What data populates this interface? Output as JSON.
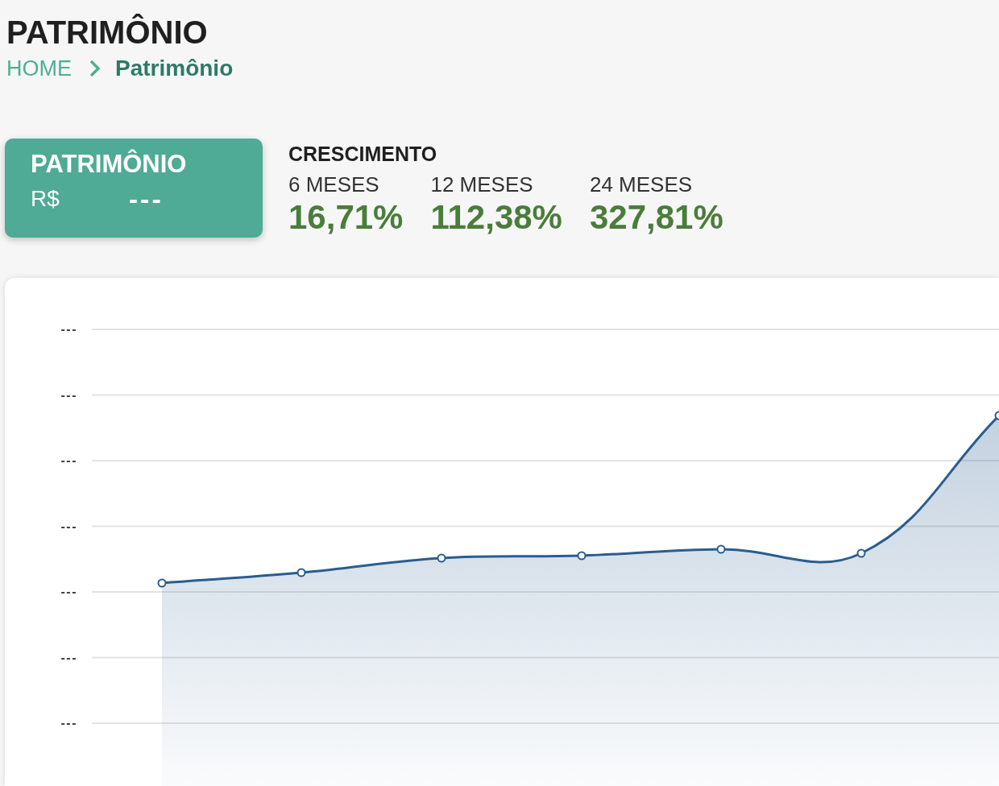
{
  "page": {
    "title": "PATRIMÔNIO"
  },
  "breadcrumb": [
    {
      "label": "HOME",
      "current": false
    },
    {
      "label": "Patrimônio",
      "current": true
    }
  ],
  "summary_card": {
    "title": "PATRIMÔNIO",
    "currency": "R$",
    "value": "---"
  },
  "growth": {
    "title": "CRESCIMENTO",
    "periods": [
      {
        "label": "6 MESES",
        "value": "16,71%"
      },
      {
        "label": "12 MESES",
        "value": "112,38%"
      },
      {
        "label": "24 MESES",
        "value": "327,81%"
      }
    ]
  },
  "chart": {
    "y_axis_labels": [
      "---",
      "---",
      "---",
      "---",
      "---",
      "---",
      "---"
    ]
  }
}
